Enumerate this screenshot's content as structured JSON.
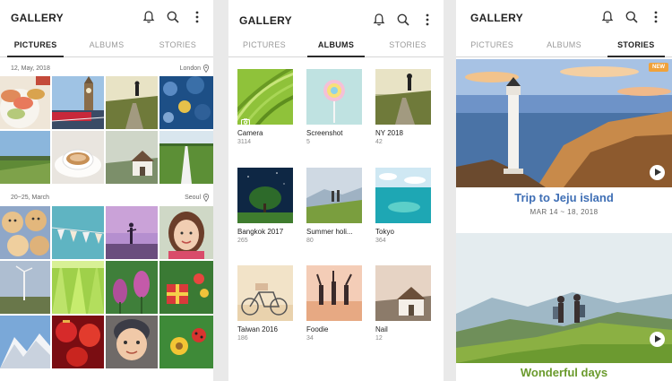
{
  "app": {
    "title": "GALLERY",
    "icons": [
      "bell-icon",
      "search-icon",
      "more-vert-icon"
    ],
    "tabs": [
      "PICTURES",
      "ALBUMS",
      "STORIES"
    ]
  },
  "pictures": {
    "groups": [
      {
        "date": "12, May, 2018",
        "location": "London"
      },
      {
        "date": "20~25, March",
        "location": "Seoul"
      }
    ]
  },
  "albums": {
    "items": [
      {
        "name": "Camera",
        "count": "3114"
      },
      {
        "name": "Screenshot",
        "count": "5"
      },
      {
        "name": "NY 2018",
        "count": "42"
      },
      {
        "name": "Bangkok 2017",
        "count": "265"
      },
      {
        "name": "Summer holi...",
        "count": "80"
      },
      {
        "name": "Tokyo",
        "count": "364"
      },
      {
        "name": "Taiwan 2016",
        "count": "186"
      },
      {
        "name": "Foodie",
        "count": "34"
      },
      {
        "name": "Nail",
        "count": "12"
      }
    ]
  },
  "stories": {
    "items": [
      {
        "title": "Trip to Jeju island",
        "date": "MAR 14 ~ 18, 2018",
        "badge": "NEW"
      },
      {
        "title": "Wonderful days"
      }
    ]
  },
  "colors": {
    "accent_blue": "#3f6fb5",
    "accent_green": "#6a9a2c",
    "badge": "#f0a23b"
  }
}
